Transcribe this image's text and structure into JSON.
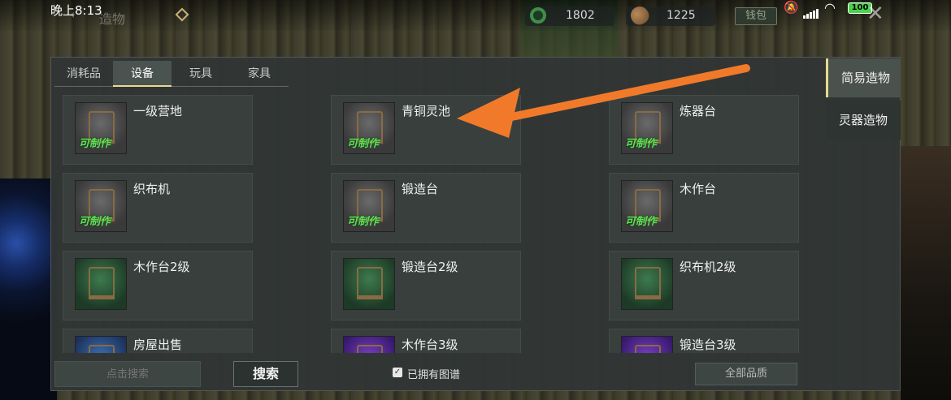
{
  "status_bar": {
    "clock": "晚上8:13",
    "screen_title": "造物",
    "battery": "100"
  },
  "currency": {
    "jade_value": "1802",
    "seed_value": "1225",
    "wallet_label": "钱包"
  },
  "tabs": [
    {
      "label": "消耗品",
      "active": false
    },
    {
      "label": "设备",
      "active": true
    },
    {
      "label": "玩具",
      "active": false
    },
    {
      "label": "家具",
      "active": false
    }
  ],
  "side_tabs": [
    {
      "label": "简易造物",
      "active": true
    },
    {
      "label": "灵器造物",
      "active": false
    }
  ],
  "items": [
    {
      "name": "一级营地",
      "craftable": true,
      "thumb": "grey"
    },
    {
      "name": "青铜灵池",
      "craftable": true,
      "thumb": "grey"
    },
    {
      "name": "炼器台",
      "craftable": true,
      "thumb": "grey"
    },
    {
      "name": "织布机",
      "craftable": true,
      "thumb": "grey"
    },
    {
      "name": "锻造台",
      "craftable": true,
      "thumb": "grey"
    },
    {
      "name": "木作台",
      "craftable": true,
      "thumb": "grey"
    },
    {
      "name": "木作台2级",
      "craftable": false,
      "thumb": "green"
    },
    {
      "name": "锻造台2级",
      "craftable": false,
      "thumb": "green"
    },
    {
      "name": "织布机2级",
      "craftable": false,
      "thumb": "green"
    },
    {
      "name": "房屋出售",
      "craftable": false,
      "thumb": "blue"
    },
    {
      "name": "木作台3级",
      "craftable": false,
      "thumb": "purple"
    },
    {
      "name": "锻造台3级",
      "craftable": false,
      "thumb": "purple"
    }
  ],
  "craftable_label": "可制作",
  "bottom": {
    "search_placeholder": "点击搜索",
    "search_button": "搜索",
    "owned_label": "已拥有图谱",
    "quality_select": "全部品质"
  },
  "colors": {
    "accent": "#e7d98f",
    "craftable_green": "#5fe05a",
    "annotation_arrow": "#f07a2a"
  }
}
